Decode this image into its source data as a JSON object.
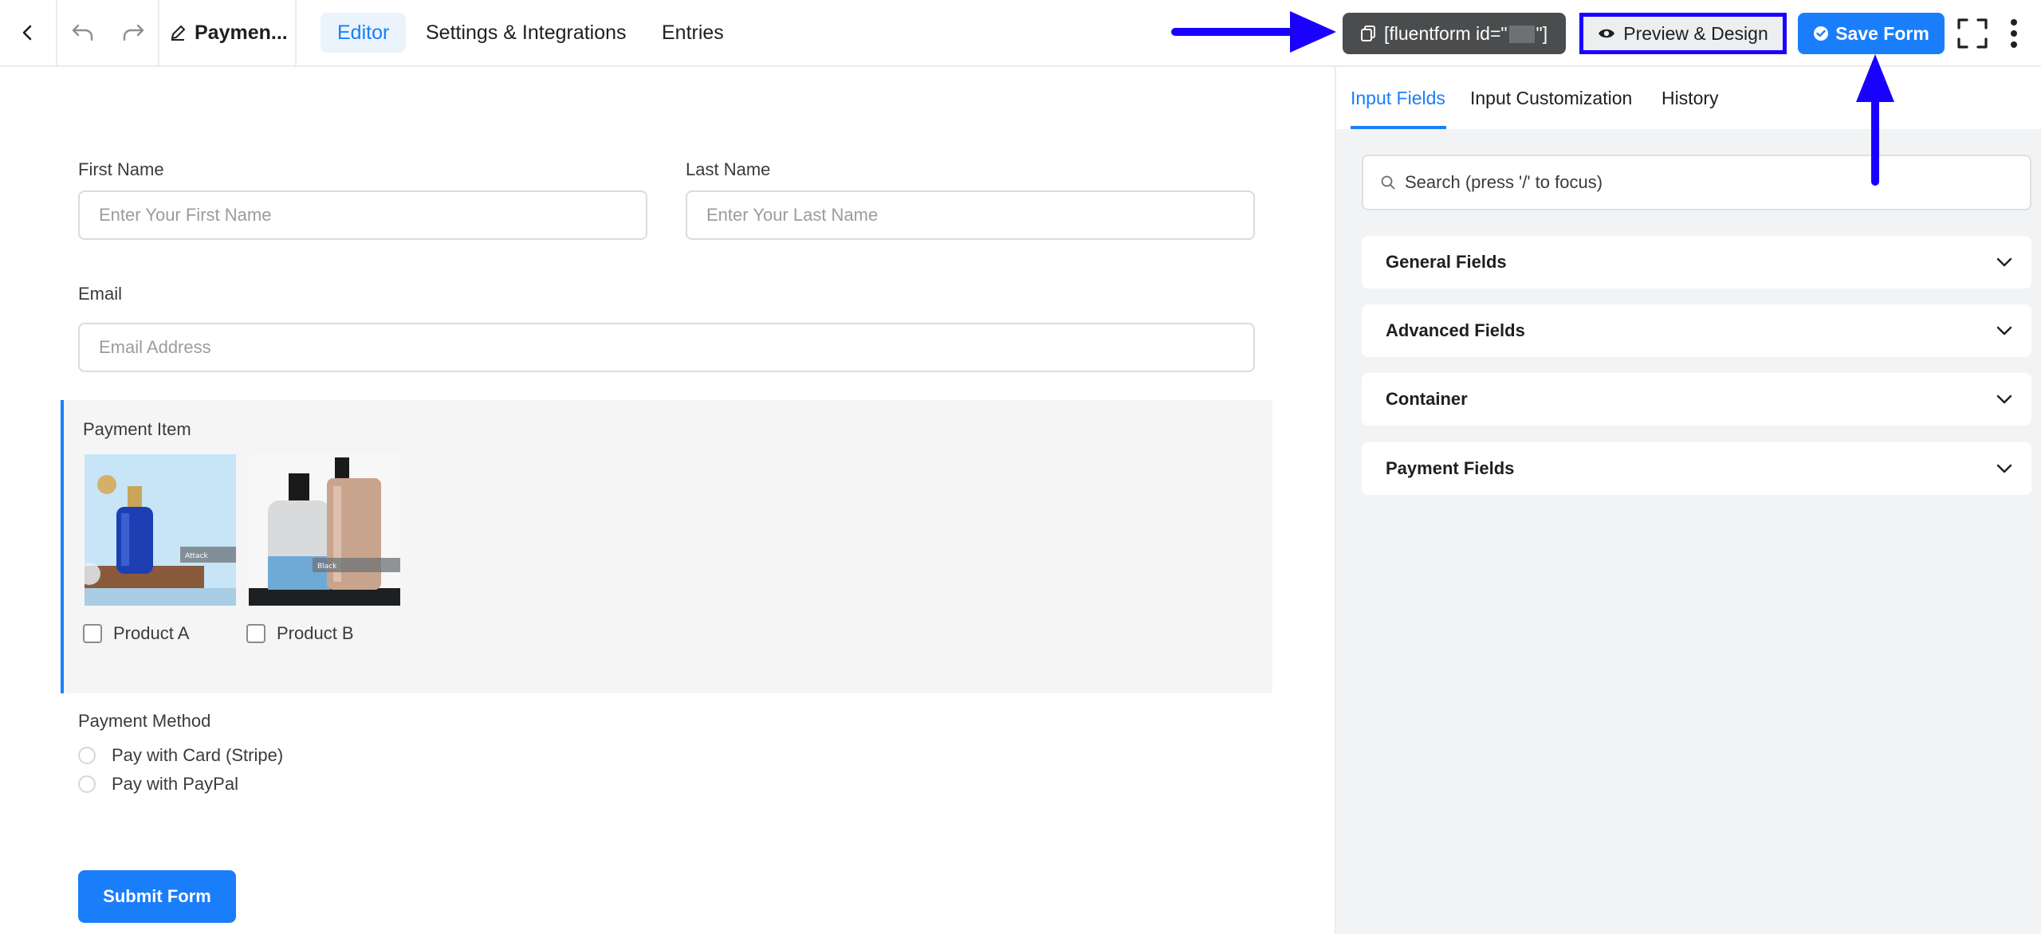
{
  "colors": {
    "accent": "#1a7efb",
    "shortcode_bg": "#4b4c4d",
    "annotation": "#1900ff",
    "sidebar_bg": "#f2f3f5"
  },
  "header": {
    "form_title": "Paymen...",
    "tabs": [
      {
        "label": "Editor",
        "active": true
      },
      {
        "label": "Settings & Integrations",
        "active": false
      },
      {
        "label": "Entries",
        "active": false
      }
    ],
    "shortcode_prefix": "[fluentform id=\"",
    "shortcode_suffix": "\"]",
    "preview_label": "Preview & Design",
    "save_label": "Save Form",
    "icons": [
      "back-icon",
      "undo-icon",
      "redo-icon",
      "edit-icon",
      "copy-icon",
      "eye-icon",
      "check-circle-icon",
      "fullscreen-icon",
      "more-vertical-icon"
    ]
  },
  "form": {
    "first_name": {
      "label": "First Name",
      "placeholder": "Enter Your First Name"
    },
    "last_name": {
      "label": "Last Name",
      "placeholder": "Enter Your Last Name"
    },
    "email": {
      "label": "Email",
      "placeholder": "Email Address"
    },
    "payment_item": {
      "label": "Payment Item",
      "products": [
        {
          "label": "Product A",
          "checked": false
        },
        {
          "label": "Product B",
          "checked": false
        }
      ]
    },
    "payment_method": {
      "label": "Payment Method",
      "options": [
        "Pay with Card (Stripe)",
        "Pay with PayPal"
      ]
    },
    "submit_label": "Submit Form"
  },
  "sidebar": {
    "tabs": [
      {
        "label": "Input Fields",
        "active": true
      },
      {
        "label": "Input Customization",
        "active": false
      },
      {
        "label": "History",
        "active": false
      }
    ],
    "search_placeholder": "Search (press '/' to focus)",
    "sections": [
      "General Fields",
      "Advanced Fields",
      "Container",
      "Payment Fields"
    ]
  }
}
